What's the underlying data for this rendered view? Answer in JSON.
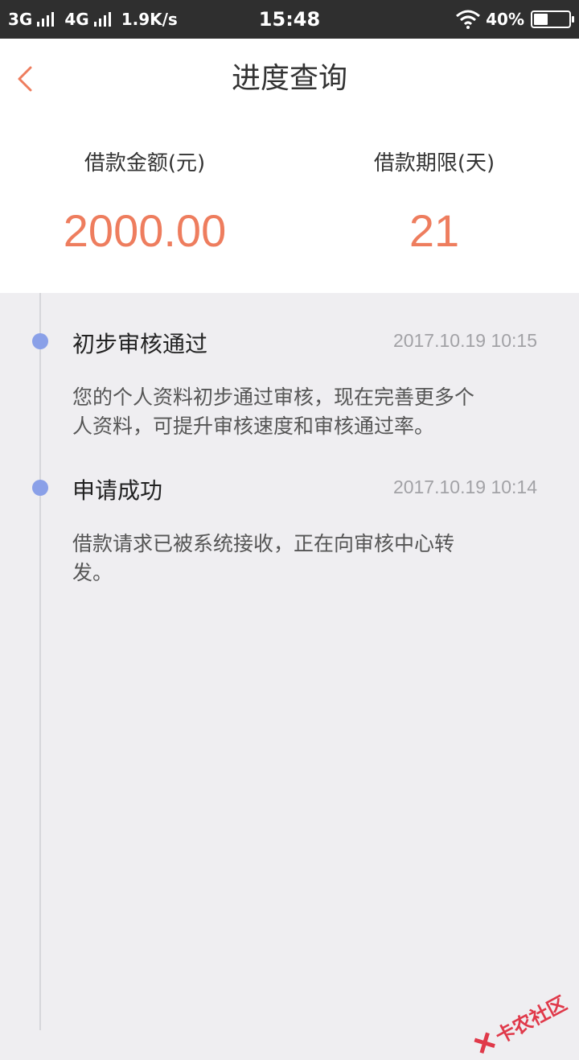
{
  "status_bar": {
    "net1": "3G",
    "net2": "4G",
    "speed": "1.9K/s",
    "time": "15:48",
    "battery": "40%",
    "battery_level": 0.4
  },
  "header": {
    "title": "进度查询",
    "back_icon": "chevron-left-icon",
    "accent_color": "#ee7d5e"
  },
  "summary": {
    "amount_label": "借款金额(元)",
    "amount_value": "2000.00",
    "term_label": "借款期限(天)",
    "term_value": "21"
  },
  "timeline": {
    "dot_color": "#8aa0e8",
    "events": [
      {
        "title": "初步审核通过",
        "time": "2017.10.19 10:15",
        "desc_line1": "您的个人资料初步通过审核，现在完善更多个",
        "desc_line2": "人资料，可提升审核速度和审核通过率。"
      },
      {
        "title": "申请成功",
        "time": "2017.10.19 10:14",
        "desc_line1": "借款请求已被系统接收，正在向审核中心转",
        "desc_line2": "发。"
      }
    ]
  },
  "watermark": {
    "text": "卡农社区"
  }
}
